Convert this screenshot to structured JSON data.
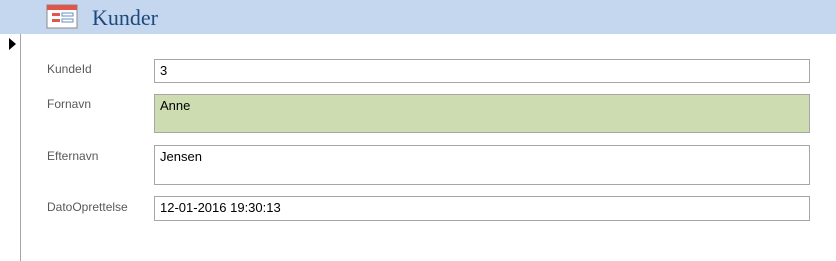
{
  "form": {
    "title": "Kunder",
    "icon": "form-icon",
    "colors": {
      "header_bg": "#c5d7ef",
      "title_text": "#1f497d",
      "active_field_bg": "#cddcb1"
    }
  },
  "record_selector": {
    "icon": "current-record-arrow-icon"
  },
  "fields": [
    {
      "label": "KundeId",
      "value": "3"
    },
    {
      "label": "Fornavn",
      "value": "Anne"
    },
    {
      "label": "Efternavn",
      "value": "Jensen"
    },
    {
      "label": "DatoOprettelse",
      "value": "12-01-2016 19:30:13"
    }
  ]
}
